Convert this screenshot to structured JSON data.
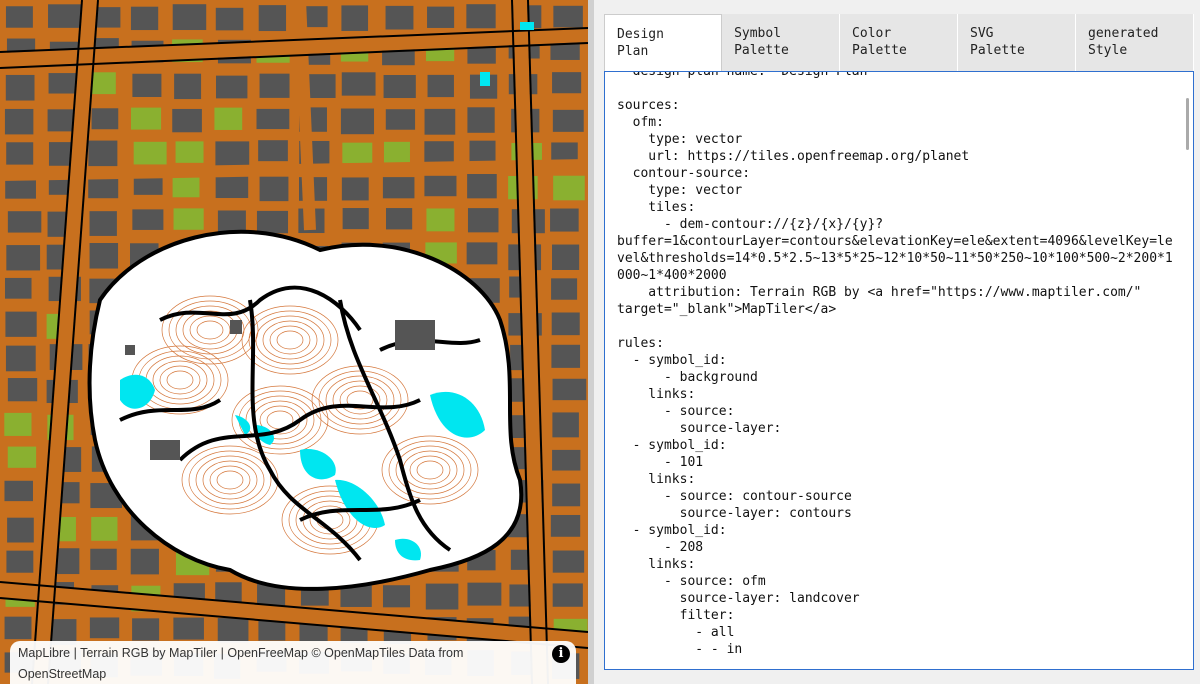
{
  "map": {
    "attribution_links": [
      "MapLibre",
      "Terrain RGB",
      "MapTiler",
      "OpenFreeMap",
      "© OpenMapTiles"
    ],
    "attribution_text": {
      "sep1": " | ",
      "by": " by ",
      "sep2": " | ",
      "sep3": " ",
      "data_from": " Data from ",
      "osm": "OpenStreetMap"
    },
    "info_icon": "i",
    "colors": {
      "roads": "#c8701e",
      "blocks": "#555555",
      "park": "#ffffff",
      "water": "#00e6f0",
      "green": "#8ab030",
      "trails": "#000000",
      "contours": "#d4763a"
    }
  },
  "tabs": [
    {
      "label": "Design\nPlan",
      "active": true
    },
    {
      "label": "Symbol\nPalette",
      "active": false
    },
    {
      "label": "Color\nPalette",
      "active": false
    },
    {
      "label": "SVG\nPalette",
      "active": false
    },
    {
      "label": "generated\nStyle",
      "active": false
    }
  ],
  "editor": {
    "lines": [
      "  design-plan-name: \"Design Plan\"",
      "",
      "sources:",
      "  ofm:",
      "    type: vector",
      "    url: https://tiles.openfreemap.org/planet",
      "  contour-source:",
      "    type: vector",
      "    tiles:",
      "      - dem-contour://{z}/{x}/{y}?",
      "buffer=1&contourLayer=contours&elevationKey=ele&extent=4096&levelKey=le",
      "vel&thresholds=14*0.5*2.5~13*5*25~12*10*50~11*50*250~10*100*500~2*200*1",
      "000~1*400*2000",
      "    attribution: Terrain RGB by <a href=\"https://www.maptiler.com/\"",
      "target=\"_blank\">MapTiler</a>",
      "",
      "rules:",
      "  - symbol_id:",
      "      - background",
      "    links:",
      "      - source:",
      "        source-layer:",
      "  - symbol_id:",
      "      - 101",
      "    links:",
      "      - source: contour-source",
      "        source-layer: contours",
      "  - symbol_id:",
      "      - 208",
      "    links:",
      "      - source: ofm",
      "        source-layer: landcover",
      "        filter:",
      "          - all",
      "          - - in"
    ]
  }
}
